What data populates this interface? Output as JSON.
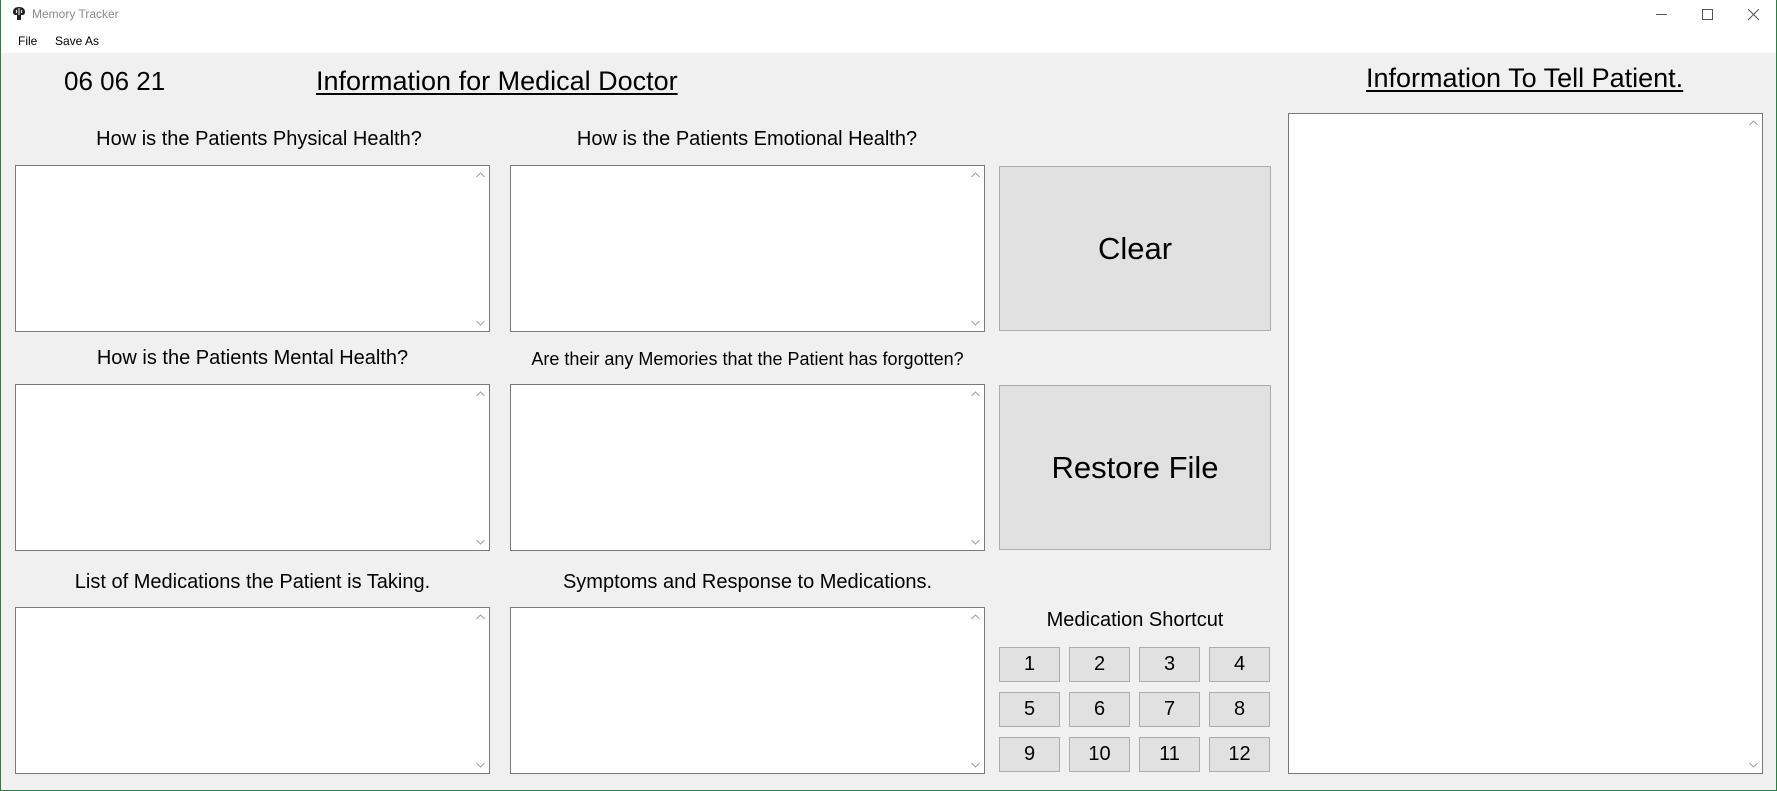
{
  "window": {
    "title": "Memory Tracker",
    "app_icon": "brain-icon",
    "controls": {
      "minimize_icon": "minimize-icon",
      "maximize_icon": "maximize-icon",
      "close_icon": "close-icon"
    }
  },
  "menubar": {
    "file_label": "File",
    "save_as_label": "Save As"
  },
  "header": {
    "date": "06 06 21",
    "doctor_heading": "Information for Medical Doctor",
    "patient_heading": "Information To Tell Patient."
  },
  "fields": {
    "physical": {
      "label": "How is the Patients Physical Health?",
      "value": ""
    },
    "emotional": {
      "label": "How is the Patients Emotional Health?",
      "value": ""
    },
    "mental": {
      "label": "How is the Patients Mental Health?",
      "value": ""
    },
    "memories": {
      "label": "Are their any Memories that the Patient has forgotten?",
      "value": ""
    },
    "medications": {
      "label": "List of Medications the Patient is Taking.",
      "value": ""
    },
    "symptoms": {
      "label": "Symptoms and Response to Medications.",
      "value": ""
    },
    "patient_info": {
      "value": ""
    }
  },
  "buttons": {
    "clear_label": "Clear",
    "restore_label": "Restore File"
  },
  "medication_shortcut": {
    "title": "Medication Shortcut",
    "buttons": [
      "1",
      "2",
      "3",
      "4",
      "5",
      "6",
      "7",
      "8",
      "9",
      "10",
      "11",
      "12"
    ]
  },
  "colors": {
    "window_bg": "#f0f0f0",
    "button_bg": "#e1e1e1",
    "border": "#7a7a7a",
    "window_frame": "#2f7a45"
  }
}
